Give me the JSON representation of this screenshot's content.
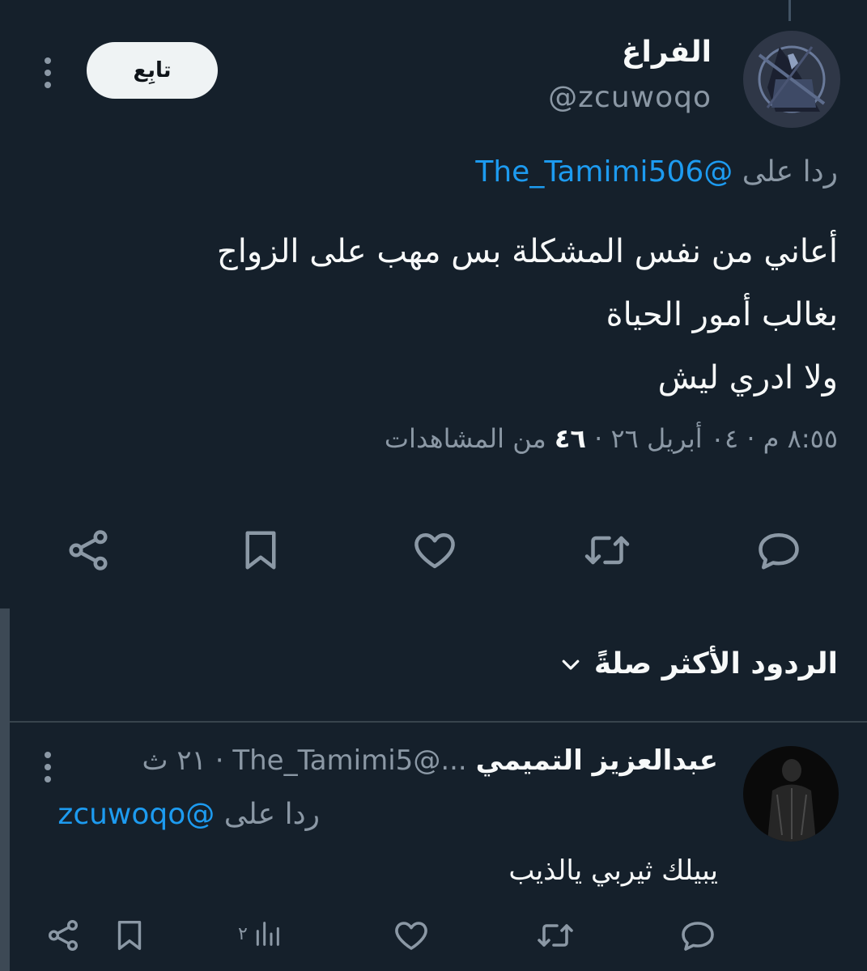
{
  "colors": {
    "background": "#15202b",
    "text_primary": "#f7f9f9",
    "text_secondary": "#8b98a5",
    "accent": "#1d9bf0",
    "divider": "#38444d"
  },
  "tweet": {
    "display_name": "الفراغ",
    "handle": "@zcuwoqo",
    "follow_label": "تابِع",
    "replying_prefix": "ردا على",
    "replying_to": "@The_Tamimi506",
    "text_lines": [
      "أعاني من نفس المشكلة بس مهب على الزواج",
      "بغالب أمور الحياة",
      "ولا ادري ليش"
    ],
    "meta": {
      "time": "٨:٥٥ م",
      "sep1": " · ",
      "date": "٠٤ أبريل ٢٦",
      "sep2": " · ",
      "views_count": "٤٦",
      "views_label": " من المشاهدات"
    },
    "actions": [
      "reply-icon",
      "retweet-icon",
      "like-icon",
      "bookmark-icon",
      "share-icon"
    ]
  },
  "replies_section": {
    "sort_label": "الردود الأكثر صلةً"
  },
  "reply": {
    "display_name": "عبدالعزيز التميمي",
    "handle_time": " ...@The_Tamimi5 · ٢١ ث",
    "replying_prefix": "ردا على",
    "replying_to": "@zcuwoqo",
    "text": "يبيلك ثيربي يالذيب",
    "views": "٢",
    "actions": [
      "reply-icon",
      "retweet-icon",
      "like-icon",
      "views-icon",
      "bookmark-icon",
      "share-icon"
    ]
  }
}
